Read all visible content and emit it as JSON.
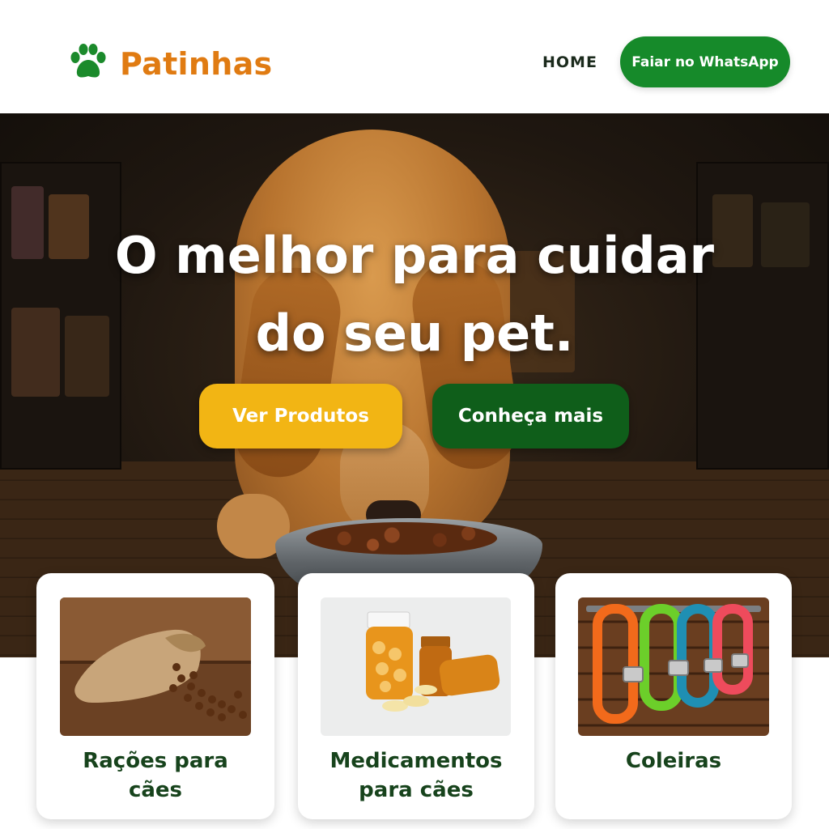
{
  "header": {
    "logo_text": "Patinhas",
    "logo_icon": "paw-icon",
    "nav_home": "HOME",
    "whatsapp_button": "Faiar no WhatsApp"
  },
  "hero": {
    "title_line1": "O melhor para cuidar",
    "title_line2": "do seu pet.",
    "primary_button": "Ver Produtos",
    "secondary_button": "Conheça mais"
  },
  "categories": [
    {
      "title_line1": "Rações para",
      "title_line2": "cães",
      "image": "dog-food-sack"
    },
    {
      "title_line1": "Medicamentos",
      "title_line2": "para cães",
      "image": "medicine-bottles"
    },
    {
      "title_line1": "Coleiras",
      "title_line2": "",
      "image": "colorful-collars"
    }
  ],
  "colors": {
    "brand_orange": "#e07b12",
    "brand_green": "#168a2a",
    "dark_green": "#0f5e1a",
    "accent_yellow": "#f2b514",
    "card_title_green": "#17431c"
  }
}
